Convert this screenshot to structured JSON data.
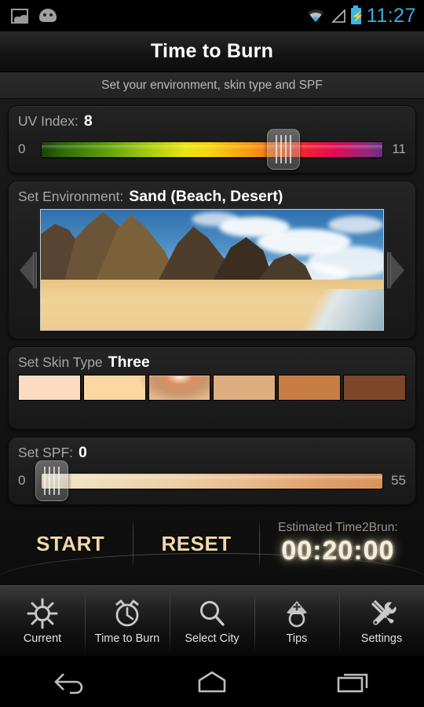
{
  "statusbar": {
    "time": "11:27",
    "icons": [
      "gallery-icon",
      "android-icon",
      "wifi-icon",
      "cell-signal-icon",
      "battery-charging-icon"
    ]
  },
  "header": {
    "title": "Time to Burn",
    "subtitle": "Set your environment, skin type and SPF"
  },
  "uv": {
    "label": "UV Index:",
    "value": "8",
    "min_label": "0",
    "max_label": "11",
    "thumb_percent": 71,
    "gradient": [
      "#1d4208",
      "#63a40d",
      "#e9e312",
      "#f79a10",
      "#ee2033",
      "#8e2a7e",
      "#6b2a86"
    ]
  },
  "environment": {
    "label": "Set Environment:",
    "value": "Sand (Beach, Desert)",
    "prev_label": "◀",
    "next_label": "▶",
    "photo_alt": "Beach with mountains and sand"
  },
  "skin": {
    "label": "Set Skin Type",
    "value": "Three",
    "selected_index": 2,
    "swatches": [
      "#fbdcc0",
      "#fbd7a3",
      "#e3b78c",
      "#deae80",
      "#c87d42",
      "#7e4629"
    ]
  },
  "spf": {
    "label": "Set SPF:",
    "value": "0",
    "min_label": "0",
    "max_label": "55",
    "thumb_percent": 3,
    "gradient": [
      "#f3e6cd",
      "#ecd0a6",
      "#e8b98a",
      "#d9935a"
    ]
  },
  "actions": {
    "start_label": "START",
    "reset_label": "RESET",
    "estimate_label": "Estimated Time2Brun:",
    "estimate_value": "00:20:00",
    "accent_color": "#f0d9a6"
  },
  "tabs": [
    {
      "label": "Current",
      "icon": "sun-icon"
    },
    {
      "label": "Time to Burn",
      "icon": "alarm-clock-icon"
    },
    {
      "label": "Select City",
      "icon": "search-icon"
    },
    {
      "label": "Tips",
      "icon": "nurse-hat-icon"
    },
    {
      "label": "Settings",
      "icon": "tools-icon"
    }
  ],
  "navbar": [
    {
      "name": "back-button",
      "icon": "back-arrow-icon"
    },
    {
      "name": "home-button",
      "icon": "home-icon"
    },
    {
      "name": "recents-button",
      "icon": "recents-icon"
    }
  ]
}
